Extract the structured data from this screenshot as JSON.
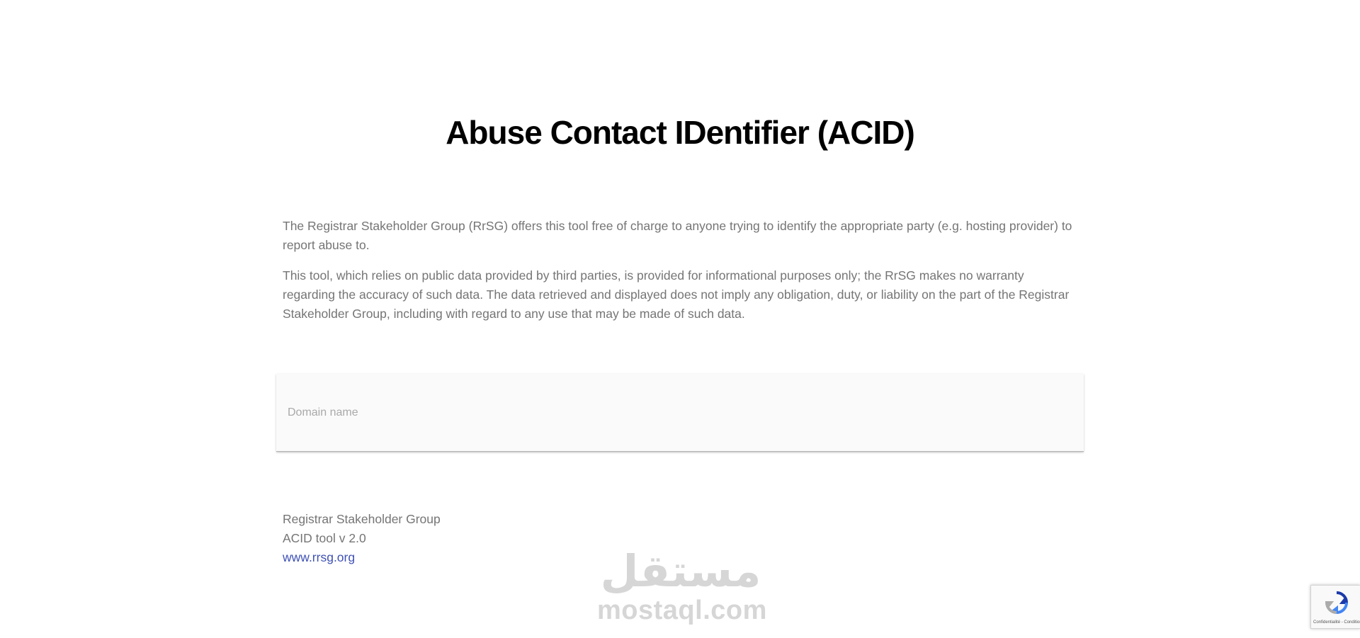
{
  "page": {
    "title": "Abuse Contact IDentifier (ACID)"
  },
  "intro": {
    "paragraph_1": "The Registrar Stakeholder Group (RrSG) offers this tool free of charge to anyone trying to identify the appropriate party (e.g. hosting provider) to report abuse to.",
    "paragraph_2": "This tool, which relies on public data provided by third parties, is provided for informational purposes only; the RrSG makes no warranty regarding the accuracy of such data. The data retrieved and displayed does not imply any obligation, duty, or liability on the part of the Registrar Stakeholder Group, including with regard to any use that may be made of such data."
  },
  "domain_input": {
    "placeholder": "Domain name",
    "value": ""
  },
  "footer": {
    "org_name": "Registrar Stakeholder Group",
    "version": "ACID tool v 2.0",
    "link_text": "www.rrsg.org"
  },
  "watermark": {
    "arabic": "مستقل",
    "latin": "mostaql.com"
  },
  "recaptcha": {
    "terms": "Confidentialité - Conditions",
    "icon": "recaptcha-icon"
  },
  "colors": {
    "title": "#000000",
    "body_text": "#757575",
    "link": "#3f51b5",
    "input_background": "#fafafa",
    "watermark": "#d6d6d6"
  }
}
